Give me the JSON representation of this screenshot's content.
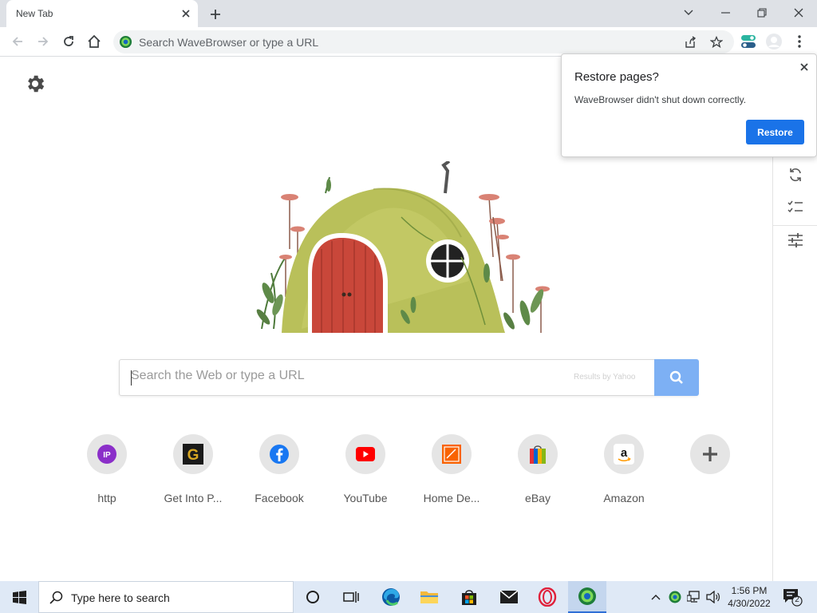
{
  "tab": {
    "title": "New Tab"
  },
  "omnibox": {
    "placeholder": "Search WaveBrowser or type a URL"
  },
  "search": {
    "placeholder": "Search the Web or type a URL",
    "brand": "Results by Yahoo"
  },
  "tiles": [
    {
      "label": "http",
      "icon": "ip-icon"
    },
    {
      "label": "Get Into P...",
      "icon": "getintopc-icon"
    },
    {
      "label": "Facebook",
      "icon": "facebook-icon"
    },
    {
      "label": "YouTube",
      "icon": "youtube-icon"
    },
    {
      "label": "Home De...",
      "icon": "home-depot-icon"
    },
    {
      "label": "eBay",
      "icon": "ebay-icon"
    },
    {
      "label": "Amazon",
      "icon": "amazon-icon"
    },
    {
      "label": "",
      "icon": "add-icon"
    }
  ],
  "popup": {
    "title": "Restore pages?",
    "message": "WaveBrowser didn't shut down correctly.",
    "button": "Restore"
  },
  "taskbar": {
    "search_placeholder": "Type here to search",
    "time": "1:56 PM",
    "date": "4/30/2022",
    "notification_count": "2"
  },
  "colors": {
    "accent": "#1a73e8",
    "search_button": "#7db0f4",
    "taskbar": "#dfe9f6",
    "tabstrip": "#dee1e6"
  }
}
